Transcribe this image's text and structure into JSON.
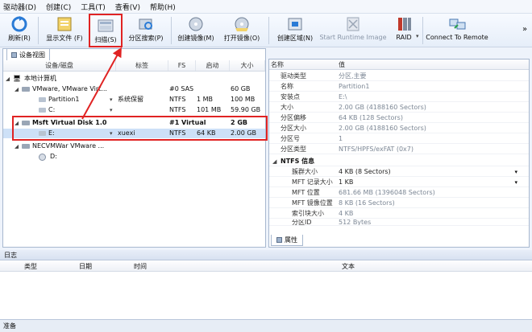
{
  "menu": [
    "驱动器(D)",
    "创建(C)",
    "工具(T)",
    "查看(V)",
    "帮助(H)"
  ],
  "toolbar": {
    "refresh": "刷新(R)",
    "show_files": "显示文件 (F)",
    "scan": "扫描(S)",
    "partition_search": "分区搜索(P)",
    "create_image": "创建镜像(M)",
    "open_image": "打开镜像(O)",
    "create_region": "创建区域(N)",
    "start_runtime_image": "Start Runtime Image",
    "raid": "RAID",
    "connect_remote": "Connect To Remote",
    "more": "»"
  },
  "left_tab": "设备视图",
  "tree_columns": [
    "设备/磁盘",
    "标签",
    "FS",
    "启动",
    "大小"
  ],
  "tree": [
    {
      "name": "本地计算机",
      "label": "",
      "fs": "",
      "start": "",
      "size": "",
      "bold": false
    },
    {
      "name": "VMware, VMware Virt...",
      "label": "",
      "fs": "#0 SAS",
      "start": "",
      "size": "60 GB",
      "bold": false
    },
    {
      "name": "Partition1",
      "label": "系统保留",
      "fs": "NTFS",
      "start": "1 MB",
      "size": "100 MB",
      "bold": false
    },
    {
      "name": "C:",
      "label": "",
      "fs": "NTFS",
      "start": "101 MB",
      "size": "59.90 GB",
      "bold": false
    },
    {
      "name": "Msft Virtual Disk 1.0",
      "label": "",
      "fs": "#1 Virtual",
      "start": "",
      "size": "2 GB",
      "bold": true
    },
    {
      "name": "E:",
      "label": "xuexi",
      "fs": "NTFS",
      "start": "64 KB",
      "size": "2.00 GB",
      "bold": false
    },
    {
      "name": "NECVMWar VMware ...",
      "label": "",
      "fs": "",
      "start": "",
      "size": "",
      "bold": false
    },
    {
      "name": "D:",
      "label": "",
      "fs": "",
      "start": "",
      "size": "",
      "bold": false
    }
  ],
  "prop_columns": [
    "名称",
    "值"
  ],
  "properties": [
    {
      "name": "驱动类型",
      "value": "分区,主要"
    },
    {
      "name": "名称",
      "value": "Partition1"
    },
    {
      "name": "安装点",
      "value": "E:\\"
    },
    {
      "name": "大小",
      "value": "2.00 GB (4188160 Sectors)"
    },
    {
      "name": "分区偏移",
      "value": "64 KB (128 Sectors)"
    },
    {
      "name": "分区大小",
      "value": "2.00 GB (4188160 Sectors)"
    },
    {
      "name": "分区号",
      "value": "1"
    },
    {
      "name": "分区类型",
      "value": "NTFS/HPFS/exFAT (0x7)"
    }
  ],
  "ntfs_section": "NTFS 信息",
  "ntfs_props": [
    {
      "name": "簇群大小",
      "value": "4 KB (8 Sectors)"
    },
    {
      "name": "MFT 记录大小",
      "value": "1 KB"
    },
    {
      "name": "MFT 位置",
      "value": "681.66 MB (1396048 Sectors)"
    },
    {
      "name": "MFT 镜像位置",
      "value": "8 KB (16 Sectors)"
    },
    {
      "name": "索引块大小",
      "value": "4 KB"
    },
    {
      "name": "分区ID",
      "value": "512 Bytes"
    }
  ],
  "prop_tab": "属性",
  "log": {
    "title": "日志",
    "columns": [
      "类型",
      "日期",
      "时间",
      "文本"
    ]
  },
  "status": "准备",
  "colors": {
    "highlight": "#e02323",
    "selection": "#cde0f7"
  }
}
